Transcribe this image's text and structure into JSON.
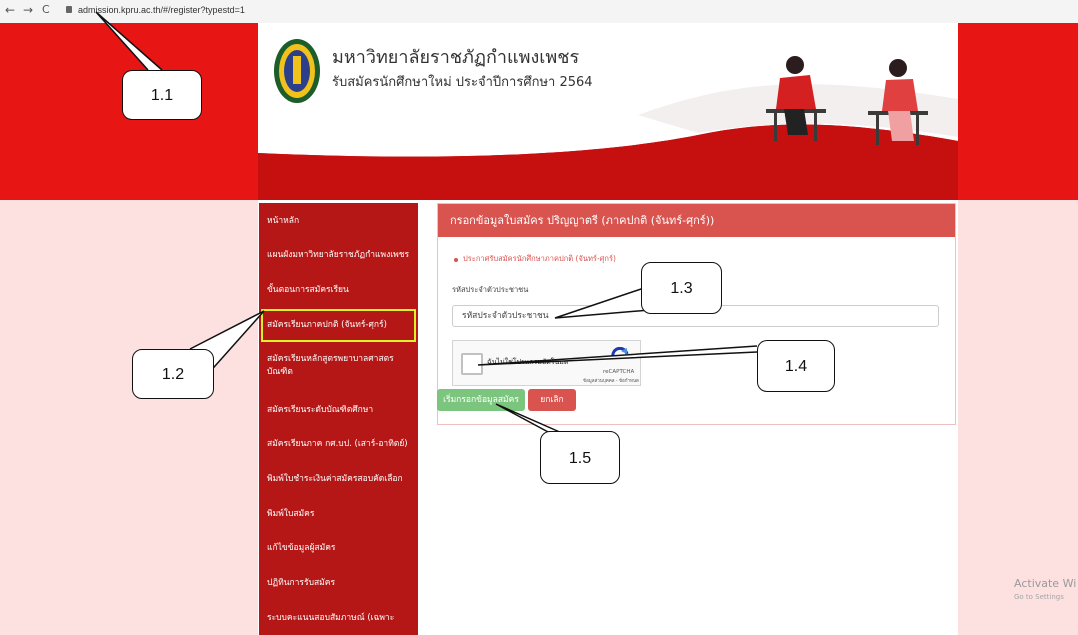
{
  "browser": {
    "back": "←",
    "forward": "→",
    "reload": "C",
    "url": "admission.kpru.ac.th/#/register?typestd=1"
  },
  "header": {
    "university_name": "มหาวิทยาลัยราชภัฏกำแพงเพชร",
    "subtitle": "รับสมัครนักศึกษาใหม่ ประจำปีการศึกษา 2564"
  },
  "sidebar": {
    "items": [
      {
        "label": "หน้าหลัก"
      },
      {
        "label": "แผนผังมหาวิทยาลัยราชภัฏกำแพงเพชร"
      },
      {
        "label": "ขั้นตอนการสมัครเรียน"
      },
      {
        "label": "สมัครเรียนภาคปกติ (จันทร์-ศุกร์)"
      },
      {
        "label": "สมัครเรียนหลักสูตรพยาบาลศาสตร บัณฑิต"
      },
      {
        "label": "สมัครเรียนระดับบัณฑิตศึกษา"
      },
      {
        "label": "สมัครเรียนภาค กศ.บป. (เสาร์-อาทิตย์)"
      },
      {
        "label": "พิมพ์ใบชำระเงินค่าสมัครสอบคัดเลือก"
      },
      {
        "label": "พิมพ์ใบสมัคร"
      },
      {
        "label": "แก้ไขข้อมูลผู้สมัคร"
      },
      {
        "label": "ปฏิทินการรับสมัคร"
      },
      {
        "label": "ระบบคะแนนสอบสัมภาษณ์ (เฉพาะ"
      }
    ]
  },
  "form": {
    "heading": "กรอกข้อมูลใบสมัคร ปริญญาตรี (ภาคปกติ (จันทร์-ศุกร์))",
    "announcement_link": "ประกาศรับสมัครนักศึกษาภาคปกติ (จันทร์-ศุกร์)",
    "id_label": "รหัสประจำตัวประชาชน",
    "id_placeholder": "รหัสประจำตัวประชาชน",
    "recaptcha_label": "ฉันไม่ใช่โปรแกรมอัตโนมัติ",
    "recaptcha_brand": "reCAPTCHA",
    "recaptcha_terms": "ข้อมูลส่วนบุคคล - ข้อกำหนด",
    "start_button": "เริ่มกรอกข้อมูลสมัคร",
    "cancel_button": "ยกเลิก"
  },
  "callouts": {
    "c1": "1.1",
    "c2": "1.2",
    "c3": "1.3",
    "c4": "1.4",
    "c5": "1.5"
  },
  "os_watermark": {
    "line1": "Activate Wi",
    "line2": "Go to Settings"
  },
  "colors": {
    "brand_red": "#e81515",
    "sidebar_red": "#b51616",
    "panel_header": "#d9534f",
    "start_button": "#7cc57f",
    "highlight": "#d9f22a"
  }
}
